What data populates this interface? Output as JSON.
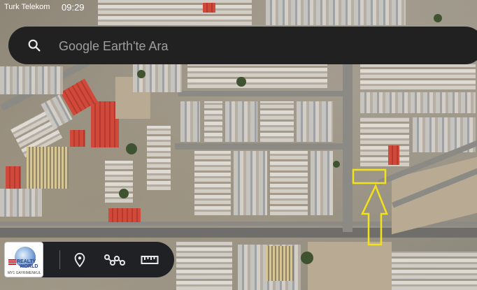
{
  "status_bar": {
    "carrier": "Turk Telekom",
    "time": "09:29"
  },
  "search": {
    "placeholder": "Google Earth'te Ara",
    "icon": "search-icon"
  },
  "toolbar": {
    "logo": {
      "line1": "REALTY",
      "line2": "WORLD",
      "tagline": "MY1 GAYRIMENKUL",
      "icon": "globe-icon"
    },
    "buttons": [
      {
        "name": "location-pin-icon"
      },
      {
        "name": "path-icon"
      },
      {
        "name": "ruler-icon"
      }
    ]
  },
  "annotation": {
    "color": "#f2e21a",
    "marker": "highlight-rectangle",
    "pointer": "up-arrow"
  }
}
